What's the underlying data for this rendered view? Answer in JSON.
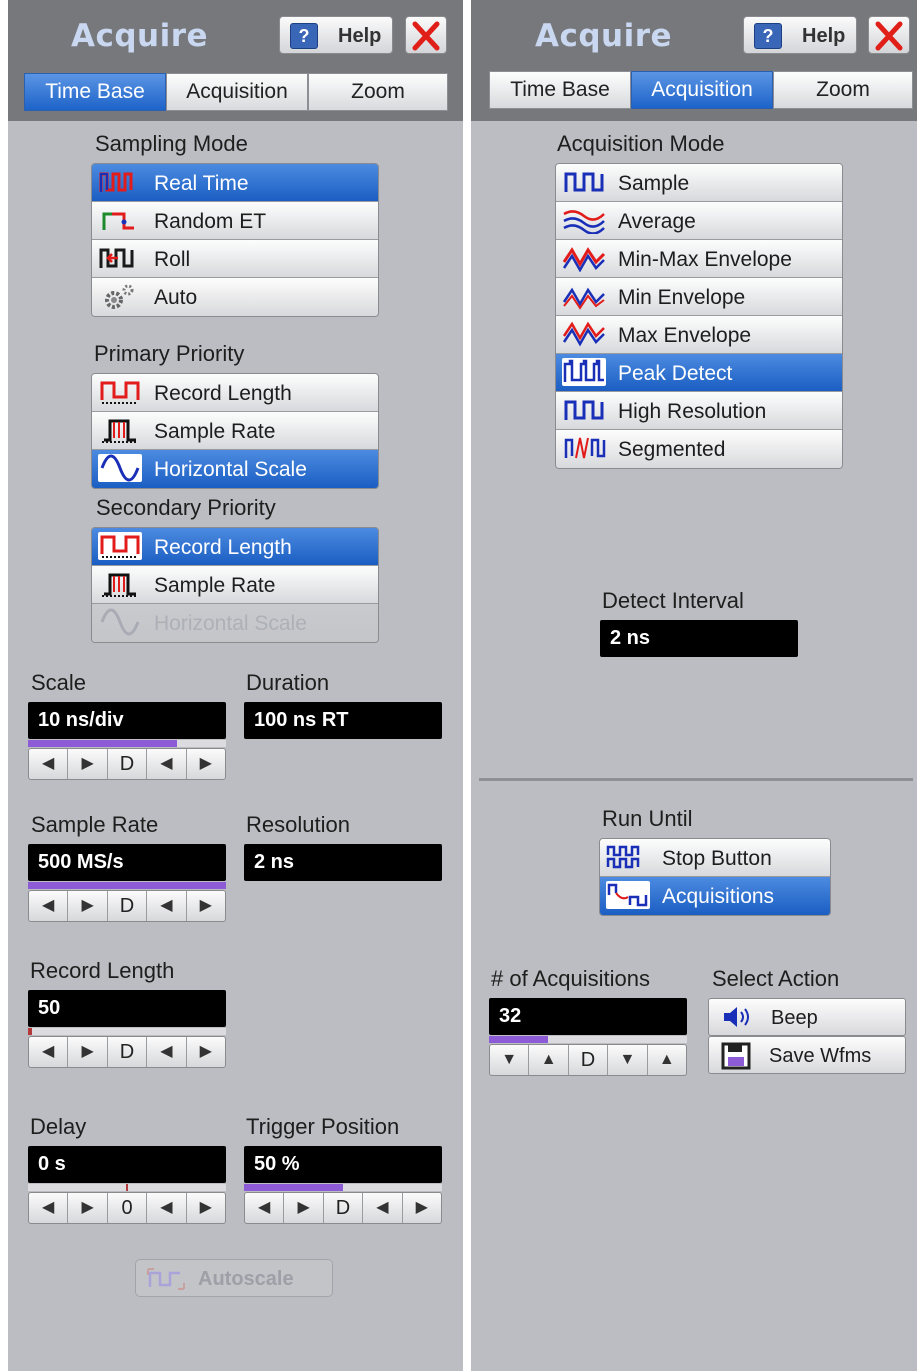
{
  "left": {
    "title": "Acquire",
    "help_label": "Help",
    "help_q": "?",
    "tabs": [
      "Time Base",
      "Acquisition",
      "Zoom"
    ],
    "active_tab": "Time Base",
    "sampling_mode": {
      "label": "Sampling Mode",
      "options": [
        {
          "label": "Real Time",
          "icon": "real-time-icon",
          "selected": true
        },
        {
          "label": "Random ET",
          "icon": "random-et-icon",
          "selected": false
        },
        {
          "label": "Roll",
          "icon": "roll-icon",
          "selected": false
        },
        {
          "label": "Auto",
          "icon": "gear-icon",
          "selected": false
        }
      ]
    },
    "primary_priority": {
      "label": "Primary Priority",
      "options": [
        {
          "label": "Record Length",
          "selected": false,
          "disabled": false
        },
        {
          "label": "Sample Rate",
          "selected": false,
          "disabled": false
        },
        {
          "label": "Horizontal Scale",
          "selected": true,
          "disabled": false
        }
      ]
    },
    "secondary_priority": {
      "label": "Secondary Priority",
      "options": [
        {
          "label": "Record Length",
          "selected": true,
          "disabled": false
        },
        {
          "label": "Sample Rate",
          "selected": false,
          "disabled": false
        },
        {
          "label": "Horizontal Scale",
          "selected": false,
          "disabled": true
        }
      ]
    },
    "scale": {
      "label": "Scale",
      "value": "10 ns/div",
      "level": 0.75
    },
    "duration": {
      "label": "Duration",
      "value": "100 ns  RT"
    },
    "sample_rate": {
      "label": "Sample Rate",
      "value": "500 MS/s",
      "level": 1.0
    },
    "resolution": {
      "label": "Resolution",
      "value": "2 ns"
    },
    "record_length": {
      "label": "Record Length",
      "value": "50",
      "level": 0.02
    },
    "delay": {
      "label": "Delay",
      "value": "0 s",
      "center_key": "0"
    },
    "trigger_position": {
      "label": "Trigger Position",
      "value": "50 %",
      "level": 0.5
    },
    "spin_default_key": "D",
    "autoscale_label": "Autoscale"
  },
  "right": {
    "title": "Acquire",
    "help_label": "Help",
    "help_q": "?",
    "tabs": [
      "Time Base",
      "Acquisition",
      "Zoom"
    ],
    "active_tab": "Acquisition",
    "acquisition_mode": {
      "label": "Acquisition Mode",
      "options": [
        {
          "label": "Sample",
          "selected": false
        },
        {
          "label": "Average",
          "selected": false
        },
        {
          "label": "Min-Max Envelope",
          "selected": false
        },
        {
          "label": "Min Envelope",
          "selected": false
        },
        {
          "label": "Max Envelope",
          "selected": false
        },
        {
          "label": "Peak Detect",
          "selected": true
        },
        {
          "label": "High Resolution",
          "selected": false
        },
        {
          "label": "Segmented",
          "selected": false
        }
      ]
    },
    "detect_interval": {
      "label": "Detect Interval",
      "value": "2 ns"
    },
    "run_until": {
      "label": "Run Until",
      "options": [
        {
          "label": "Stop Button",
          "selected": false
        },
        {
          "label": "Acquisitions",
          "selected": true
        }
      ]
    },
    "num_acquisitions": {
      "label": "# of Acquisitions",
      "value": "32",
      "level": 0.3
    },
    "select_action": {
      "label": "Select Action",
      "options": [
        {
          "label": "Beep",
          "icon": "speaker-icon"
        },
        {
          "label": "Save Wfms",
          "icon": "floppy-disk-icon"
        }
      ]
    },
    "spin_default_key": "D"
  },
  "colors": {
    "panel": "#bcbdc2",
    "header": "#77787c",
    "selected": "#1d63c9",
    "title": "#c9d8f0",
    "level_bar": "#8d5bd6"
  }
}
